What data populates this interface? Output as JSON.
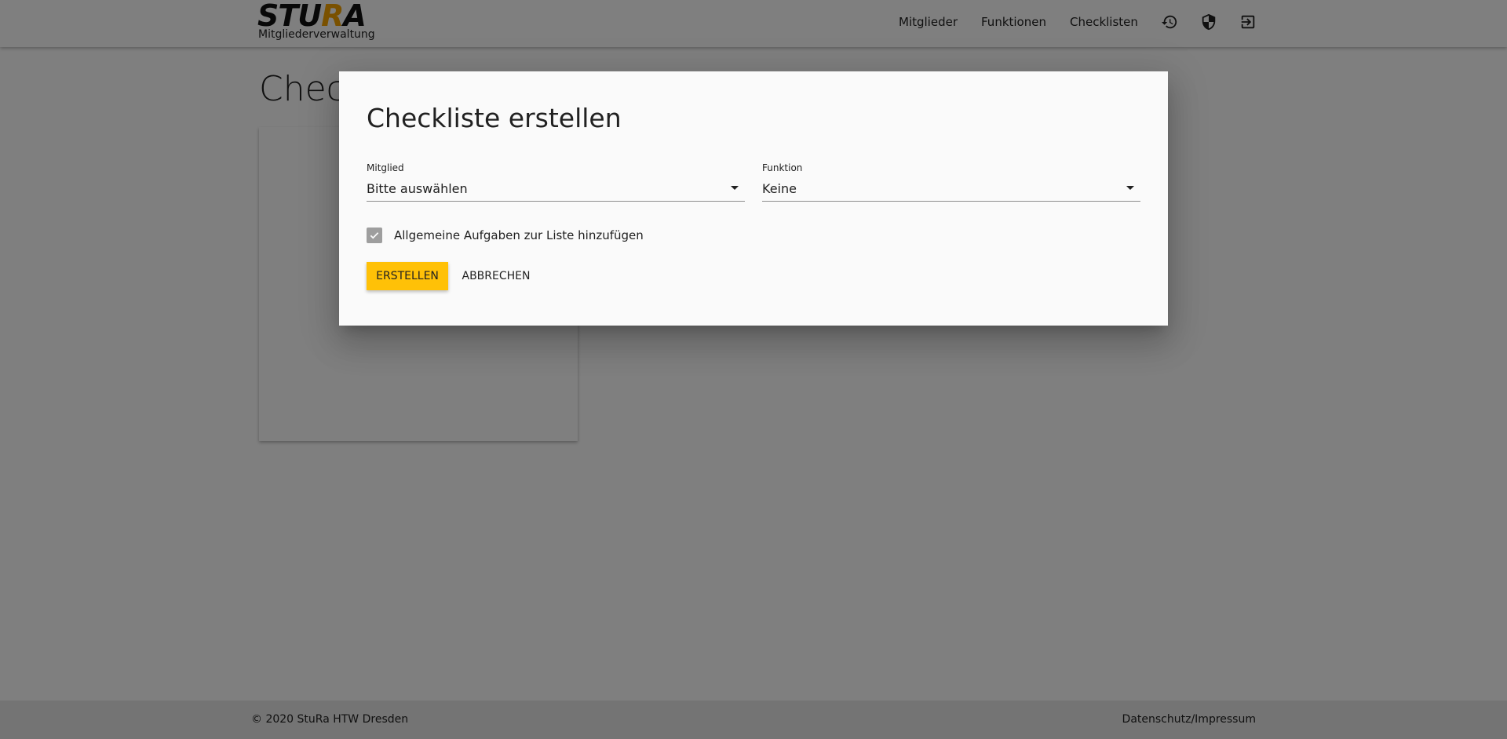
{
  "header": {
    "logo_text_1": "STU",
    "logo_text_accent": "R",
    "logo_text_2": "A",
    "logo_subtitle": "Mitgliederverwaltung",
    "nav": {
      "members": "Mitglieder",
      "functions": "Funktionen",
      "checklists": "Checklisten"
    },
    "icons": [
      "history-icon",
      "shield-icon",
      "logout-icon"
    ]
  },
  "main": {
    "page_title": "Checklisten"
  },
  "dialog": {
    "title": "Checkliste erstellen",
    "member_field": {
      "label": "Mitglied",
      "value": "Bitte auswählen"
    },
    "function_field": {
      "label": "Funktion",
      "value": "Keine"
    },
    "general_tasks_checkbox": {
      "label": "Allgemeine Aufgaben zur Liste hinzufügen",
      "checked": true
    },
    "create_button": "ERSTELLEN",
    "cancel_button": "ABBRECHEN"
  },
  "footer": {
    "copyright": "© 2020 StuRa HTW Dresden",
    "privacy_link": "Datenschutz/Impressum"
  },
  "colors": {
    "accent": "#ffc107",
    "logo_accent": "#f5a200",
    "overlay": "rgba(0,0,0,0.5)"
  }
}
